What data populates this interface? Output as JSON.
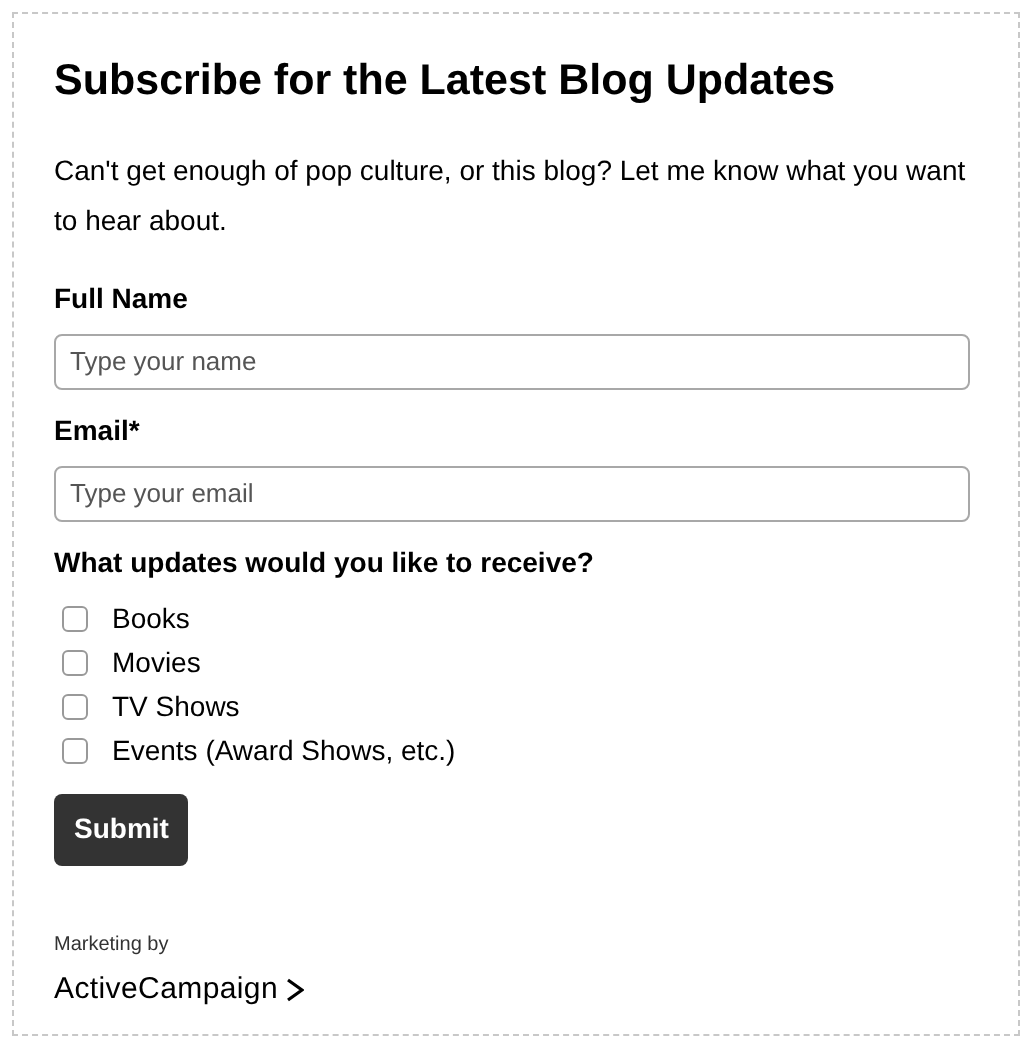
{
  "title": "Subscribe for the Latest Blog Updates",
  "intro": "Can't get enough of pop culture, or this blog? Let me know what you want to hear about.",
  "fields": [
    {
      "label": "Full Name",
      "placeholder": "Type your name"
    },
    {
      "label": "Email*",
      "placeholder": "Type your email"
    }
  ],
  "question": "What updates would you like to receive?",
  "options": [
    {
      "label": "Books",
      "checked": false
    },
    {
      "label": "Movies",
      "checked": false
    },
    {
      "label": "TV Shows",
      "checked": false
    },
    {
      "label": "Events (Award Shows, etc.)",
      "checked": false
    }
  ],
  "submit": "Submit",
  "footer": {
    "caption": "Marketing by",
    "brand": "ActiveCampaign"
  }
}
